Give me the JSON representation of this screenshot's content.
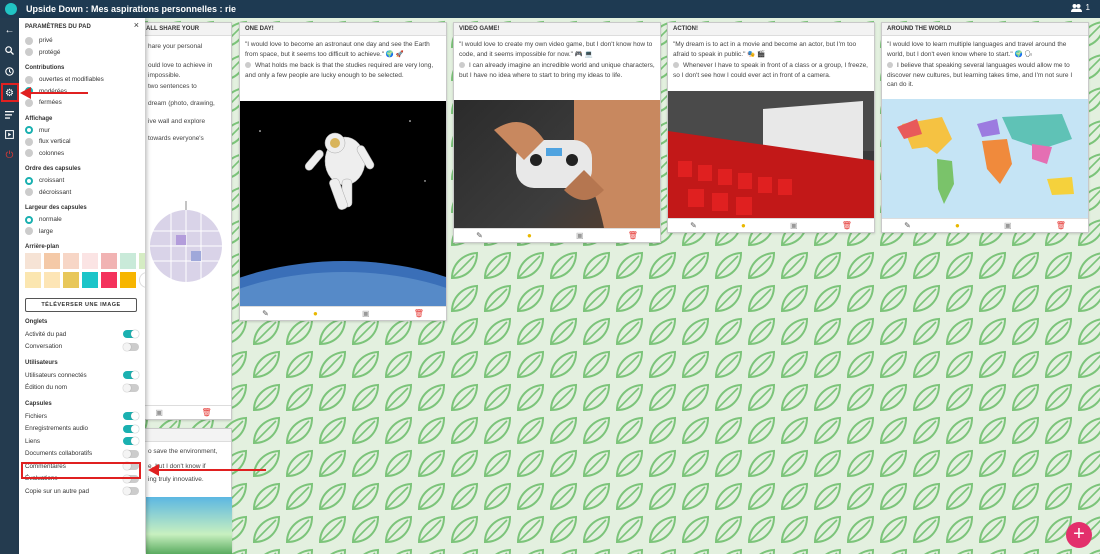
{
  "topbar": {
    "title": "Upside Down : Mes aspirations personnelles : rie",
    "users_count": "1"
  },
  "nav": {
    "icons": [
      "back-arrow-icon",
      "search-icon",
      "clock-icon",
      "gear-icon",
      "menu-lines-icon",
      "play-icon",
      "power-icon"
    ]
  },
  "panel": {
    "title": "PARAMÈTRES DU PAD",
    "close": "×",
    "access_partial": "privé",
    "access_protected": "protégé",
    "contributions": {
      "label": "Contributions",
      "options": [
        "ouvertes et modifiables",
        "modérées",
        "fermées"
      ]
    },
    "display": {
      "label": "Affichage",
      "options": [
        "mur",
        "flux vertical",
        "colonnes"
      ]
    },
    "order": {
      "label": "Ordre des capsules",
      "options": [
        "croissant",
        "décroissant"
      ]
    },
    "width": {
      "label": "Largeur des capsules",
      "options": [
        "normale",
        "large"
      ]
    },
    "background": {
      "label": "Arrière-plan",
      "upload": "TÉLÉVERSER UNE IMAGE",
      "swatch_colors": [
        "#f6e3d5",
        "#f4c9a7",
        "#f7d6c6",
        "#fbe4e4",
        "#f1b3b3",
        "#c9ead9",
        "#d5ecc3",
        "#fbe6b0",
        "#fde5b5",
        "#e8c75a",
        "#1cc5c9",
        "#f4325c",
        "#f7b500",
        "#ffffff"
      ]
    },
    "tabs": {
      "label": "Onglets",
      "items": [
        {
          "label": "Activité du pad",
          "on": true
        },
        {
          "label": "Conversation",
          "on": false
        }
      ]
    },
    "users": {
      "label": "Utilisateurs",
      "items": [
        {
          "label": "Utilisateurs connectés",
          "on": true
        },
        {
          "label": "Édition du nom",
          "on": false
        }
      ]
    },
    "capsules": {
      "label": "Capsules",
      "items": [
        {
          "label": "Fichiers",
          "on": true
        },
        {
          "label": "Enregistrements audio",
          "on": true
        },
        {
          "label": "Liens",
          "on": true
        },
        {
          "label": "Documents collaboratifs",
          "on": false
        },
        {
          "label": "Commentaires",
          "on": false
        },
        {
          "label": "Évaluations",
          "on": false
        },
        {
          "label": "Copie sur un autre pad",
          "on": false
        }
      ]
    }
  },
  "background_cards": {
    "first": {
      "title_fragment": "ALL SHARE YOUR",
      "lines": [
        "hare your personal",
        "ould love to achieve in",
        "impossible.",
        "two sentences to",
        "dream (photo, drawing,",
        "ive wall and explore",
        "towards everyone's"
      ]
    },
    "second": {
      "lines": [
        "o save the environment,",
        "e, but I don't know if",
        "ing truly innovative."
      ]
    }
  },
  "cards": [
    {
      "title": "ONE DAY!",
      "text1": "\"I would love to become an astronaut one day and see the Earth from space, but it seems too difficult to achieve.\" 🌍 🚀",
      "text2": "What holds me back is that the studies required are very long, and only a few people are lucky enough to be selected."
    },
    {
      "title": "VIDEO GAME!",
      "text1": "\"I would love to create my own video game, but I don't know how to code, and it seems impossible for now.\" 🎮 💻",
      "text2": "I can already imagine an incredible world and unique characters, but I have no idea where to start to bring my ideas to life."
    },
    {
      "title": "ACTION!",
      "text1": "\"My dream is to act in a movie and become an actor, but I'm too afraid to speak in public.\" 🎭 🎬",
      "text2": "Whenever I have to speak in front of a class or a group, I freeze, so I don't see how I could ever act in front of a camera."
    },
    {
      "title": "AROUND THE WORLD",
      "text1": "\"I would love to learn multiple languages and travel around the world, but I don't even know where to start.\" 🌍 🗣",
      "text2": "I believe that speaking several languages would allow me to discover new cultures, but learning takes time, and I'm not sure I can do it."
    }
  ],
  "fab": "+"
}
